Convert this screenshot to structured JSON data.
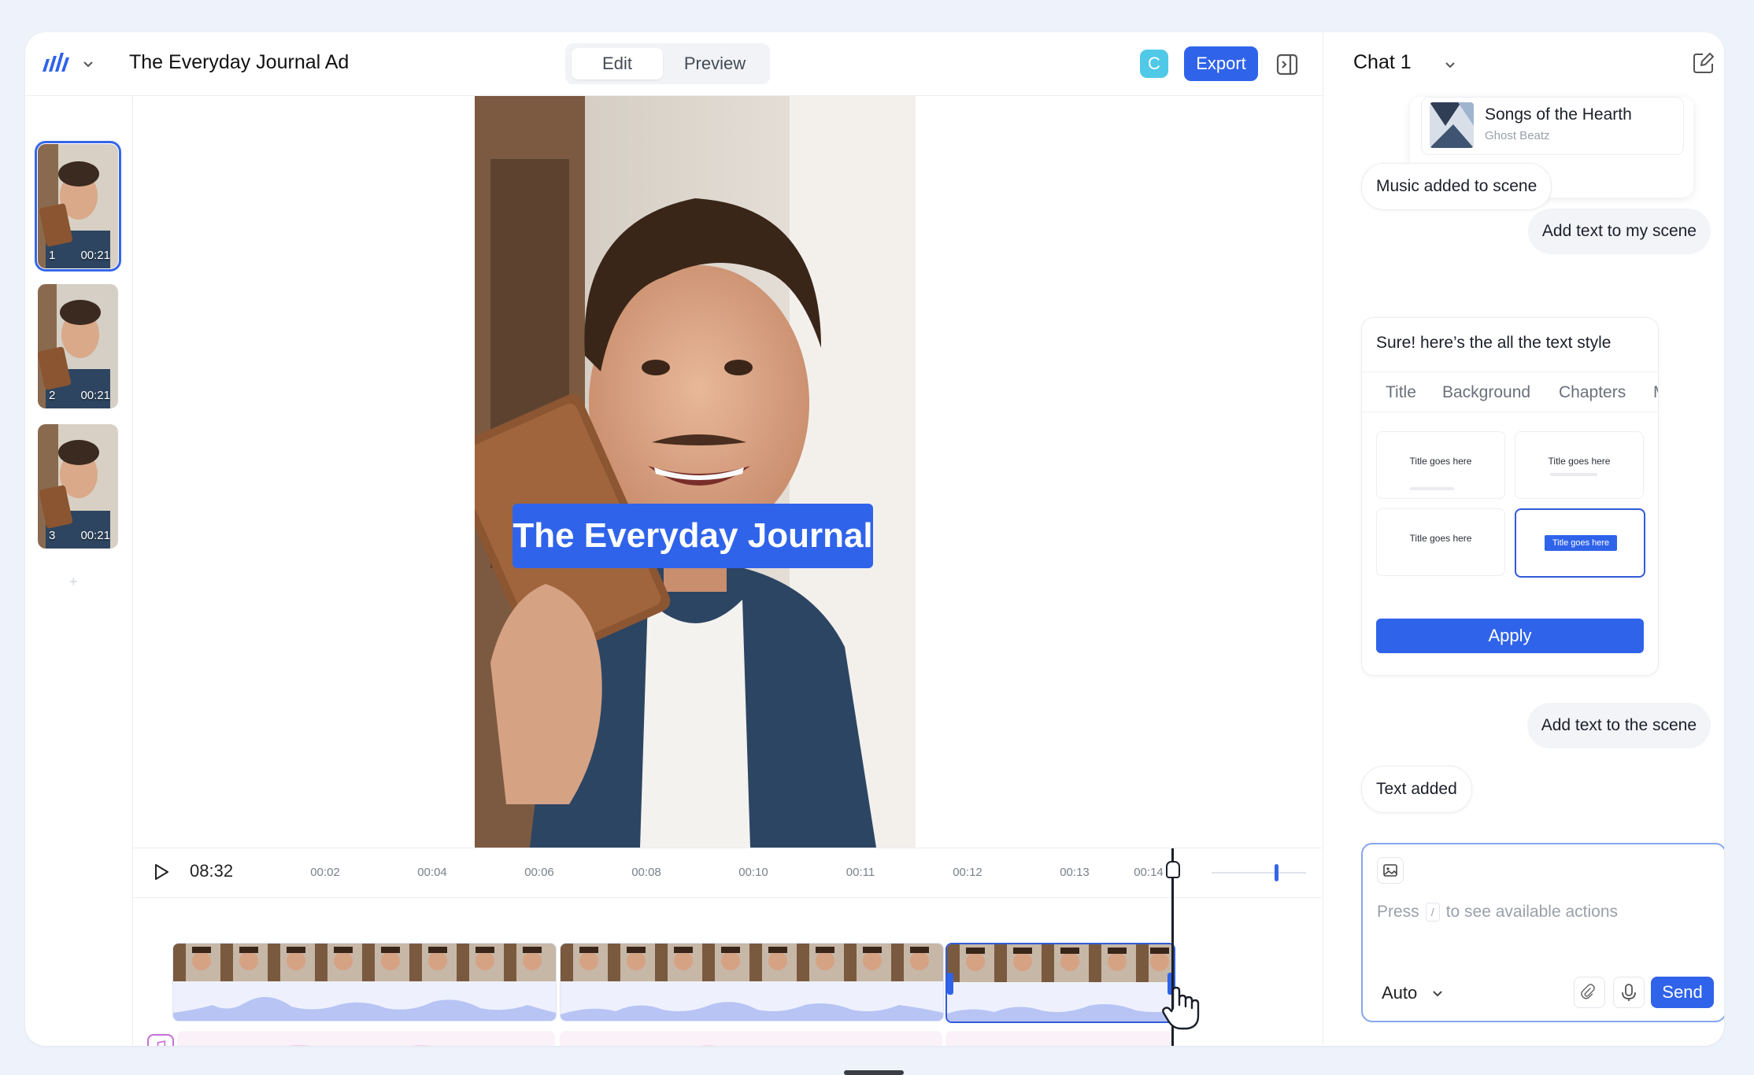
{
  "header": {
    "doc_title": "The Everyday Journal Ad",
    "modes": {
      "edit": "Edit",
      "preview": "Preview",
      "active": "Edit"
    },
    "collaborator_initial": "C",
    "export_label": "Export"
  },
  "scenes": [
    {
      "number": "1",
      "duration": "00:21",
      "selected": true
    },
    {
      "number": "2",
      "duration": "00:21",
      "selected": false
    },
    {
      "number": "3",
      "duration": "00:21",
      "selected": false
    }
  ],
  "preview": {
    "caption": "The Everyday Journal"
  },
  "timeline": {
    "current_time": "08:32",
    "ticks": [
      "00:02",
      "00:04",
      "00:06",
      "00:08",
      "00:10",
      "00:11",
      "00:12",
      "00:13",
      "00:14"
    ]
  },
  "chat": {
    "title": "Chat 1",
    "music_card": {
      "song": "Songs of the Hearth",
      "artist": "Ghost Beatz"
    },
    "messages": [
      {
        "role": "ai",
        "text": "Music added to scene"
      },
      {
        "role": "user",
        "text": "Add text to my scene"
      },
      {
        "role": "ai",
        "text": "Sure! here’s the all the text style"
      },
      {
        "role": "user",
        "text": "Add text to the scene"
      },
      {
        "role": "ai",
        "text": "Text added"
      }
    ],
    "style_tabs": [
      "Title",
      "Background",
      "Chapters",
      "M"
    ],
    "style_options": [
      {
        "label": "Title goes here",
        "selected": false
      },
      {
        "label": "Title goes here",
        "selected": false
      },
      {
        "label": "Title goes here",
        "selected": false
      },
      {
        "label": "Title goes here",
        "selected": true
      }
    ],
    "apply_label": "Apply",
    "composer": {
      "placeholder_prefix": "Press",
      "placeholder_key": "/",
      "placeholder_suffix": "to see available actions",
      "mode": "Auto",
      "send_label": "Send"
    }
  },
  "colors": {
    "accent": "#2f63ea",
    "collaborator": "#4fc9e7",
    "music": "#c56fd4"
  }
}
